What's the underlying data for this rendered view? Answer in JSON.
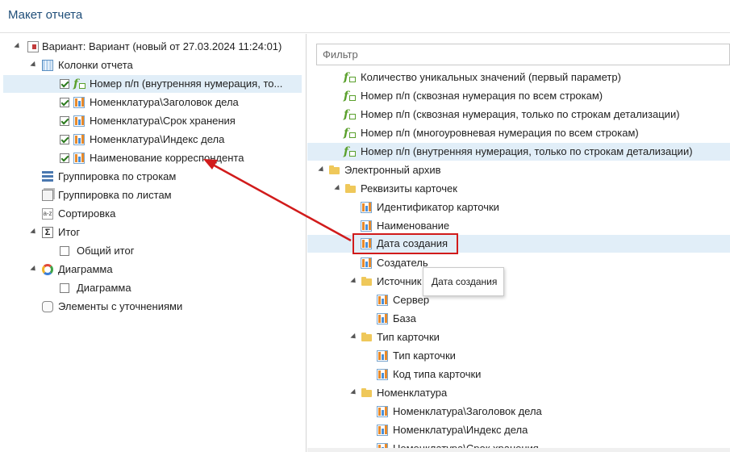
{
  "window": {
    "title": "Макет отчета"
  },
  "left_tree": {
    "variant": {
      "label": "Вариант: Вариант (новый от 27.03.2024 11:24:01)",
      "icon": "report-doc-icon"
    },
    "columns": {
      "label": "Колонки отчета",
      "icon": "table-columns-icon"
    },
    "column_items": [
      {
        "label": "Номер п/п (внутренняя нумерация, то...",
        "icon": "fx-function-icon",
        "checked": true
      },
      {
        "label": "Номенклатура\\Заголовок дела",
        "icon": "field-icon",
        "checked": true
      },
      {
        "label": "Номенклатура\\Срок хранения",
        "icon": "field-icon",
        "checked": true
      },
      {
        "label": "Номенклатура\\Индекс дела",
        "icon": "field-icon",
        "checked": true
      },
      {
        "label": "Наименование корреспондента",
        "icon": "field-icon",
        "checked": true
      }
    ],
    "row_grouping": {
      "label": "Группировка по строкам",
      "icon": "row-grouping-icon"
    },
    "sheet_grouping": {
      "label": "Группировка по листам",
      "icon": "sheet-grouping-icon"
    },
    "sorting": {
      "label": "Сортировка",
      "icon": "sort-az-icon"
    },
    "total": {
      "label": "Итог",
      "icon": "sigma-icon"
    },
    "grand_total": {
      "label": "Общий итог",
      "checked": false
    },
    "diagram": {
      "label": "Диаграмма",
      "icon": "donut-chart-icon"
    },
    "diagram_item": {
      "label": "Диаграмма",
      "checked": false
    },
    "refinements": {
      "label": "Элементы с уточнениями",
      "icon": "puzzle-icon"
    }
  },
  "right_panel": {
    "filter_placeholder": "Фильтр",
    "fx_items": [
      "Количество уникальных значений (первый параметр)",
      "Номер п/п (сквозная нумерация по всем строкам)",
      "Номер п/п (сквозная нумерация, только по строкам детализации)",
      "Номер п/п (многоуровневая нумерация по всем строкам)",
      "Номер п/п (внутренняя нумерация, только по строкам детализации)"
    ],
    "archive": "Электронный архив",
    "card_props": "Реквизиты карточек",
    "card_fields": [
      "Идентификатор карточки",
      "Наименование",
      "Дата создания",
      "Создатель"
    ],
    "source": "Источник",
    "source_fields": [
      "Сервер",
      "База"
    ],
    "card_type": "Тип карточки",
    "card_type_fields": [
      "Тип карточки",
      "Код типа карточки"
    ],
    "nomenclature": "Номенклатура",
    "nomenclature_fields": [
      "Номенклатура\\Заголовок дела",
      "Номенклатура\\Индекс дела",
      "Номенклатура\\Срок хранения"
    ],
    "tooltip": "Дата создания"
  },
  "colors": {
    "selection": "#e1eef8",
    "annotation_red": "#d11b1b",
    "title": "#1f4e79",
    "folder": "#efc85a",
    "fx_green": "#5aa02c"
  }
}
